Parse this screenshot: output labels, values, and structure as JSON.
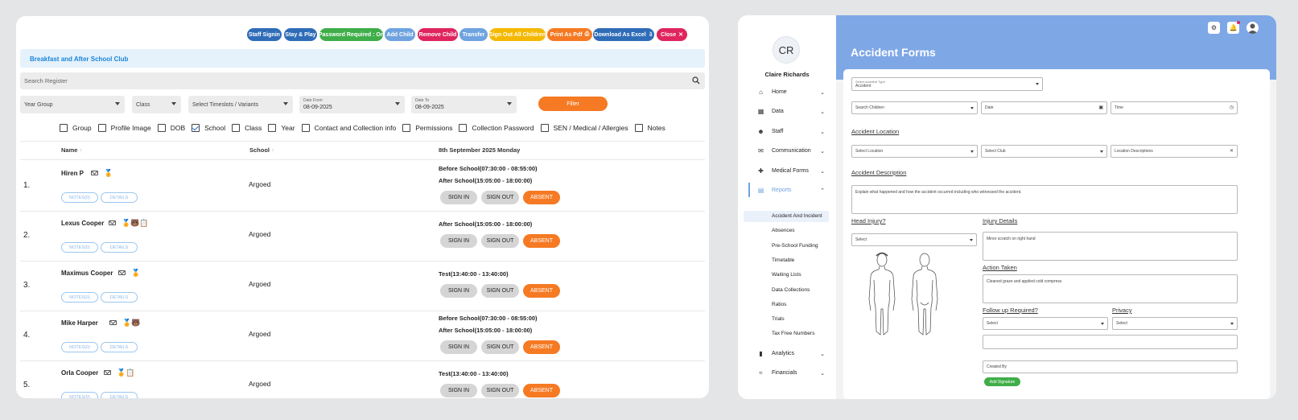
{
  "toolbar": {
    "buttons": [
      {
        "label": "Staff Signin",
        "color": "#2f6cb8"
      },
      {
        "label": "Stay & Play",
        "color": "#2f6cb8"
      },
      {
        "label": "Password Required : On",
        "color": "#3fae49"
      },
      {
        "label": "Add Child",
        "color": "#6fa3e0"
      },
      {
        "label": "Remove Child",
        "color": "#e0245e"
      },
      {
        "label": "Transfer",
        "color": "#6fa3e0"
      },
      {
        "label": "Sign Out All Children",
        "color": "#f5b800"
      },
      {
        "label": "Print As Pdf",
        "color": "#f57a23"
      },
      {
        "label": "Download As Excel",
        "color": "#2f6cb8"
      },
      {
        "label": "Close",
        "color": "#e0245e"
      }
    ]
  },
  "register": {
    "banner": "Breakfast and After School Club",
    "search_placeholder": "Search Register",
    "filters": {
      "year_group": "Year Group",
      "class": "Class",
      "timeslots": "Select Timeslots / Variants",
      "date_from_label": "Date From",
      "date_from": "08-09-2025",
      "date_to_label": "Date To",
      "date_to": "08-09-2025",
      "filter_button": "Filter"
    },
    "columns_toggle": [
      {
        "label": "Group",
        "checked": false
      },
      {
        "label": "Profile Image",
        "checked": false
      },
      {
        "label": "DOB",
        "checked": false
      },
      {
        "label": "School",
        "checked": true
      },
      {
        "label": "Class",
        "checked": false
      },
      {
        "label": "Year",
        "checked": false
      },
      {
        "label": "Contact and Collection info",
        "checked": false
      },
      {
        "label": "Permissions",
        "checked": false
      },
      {
        "label": "Collection Password",
        "checked": false
      },
      {
        "label": "SEN / Medical / Allergies",
        "checked": false
      },
      {
        "label": "Notes",
        "checked": false
      }
    ],
    "headers": {
      "name": "Name",
      "school": "School",
      "date": "8th September 2025 Monday"
    },
    "notes_label": "NOTES(0)",
    "details_label": "DETAILS",
    "sign_in": "SIGN IN",
    "sign_out": "SIGN OUT",
    "absent": "ABSENT",
    "rows": [
      {
        "num": "1.",
        "name": "Hiren P",
        "school": "Argoed",
        "sessions": [
          "Before School(07:30:00 - 08:55:00)",
          "After School(15:05:00 - 18:00:00)"
        ]
      },
      {
        "num": "2.",
        "name": "Lexus Cooper",
        "school": "Argoed",
        "sessions": [
          "After School(15:05:00 - 18:00:00)"
        ]
      },
      {
        "num": "3.",
        "name": "Maximus Cooper",
        "school": "Argoed",
        "sessions": [
          "Test(13:40:00 - 13:40:00)"
        ]
      },
      {
        "num": "4.",
        "name": "Mike Harper",
        "school": "Argoed",
        "sessions": [
          "Before School(07:30:00 - 08:55:00)",
          "After School(15:05:00 - 18:00:00)"
        ]
      },
      {
        "num": "5.",
        "name": "Orla Cooper",
        "school": "Argoed",
        "sessions": [
          "Test(13:40:00 - 13:40:00)"
        ]
      }
    ]
  },
  "sidebar": {
    "initials": "CR",
    "user_name": "Claire Richards",
    "items": [
      {
        "label": "Home",
        "icon": "home-icon"
      },
      {
        "label": "Data",
        "icon": "book-icon"
      },
      {
        "label": "Staff",
        "icon": "person-icon"
      },
      {
        "label": "Communication",
        "icon": "mail-icon"
      },
      {
        "label": "Medical Forms",
        "icon": "medical-cross-icon"
      },
      {
        "label": "Reports",
        "icon": "chart-icon"
      }
    ],
    "report_subitems": [
      "Accident And Incident",
      "Absences",
      "Pre-School Funding",
      "Timetable",
      "Waiting Lists",
      "Data Collections",
      "Ratios",
      "Trials",
      "Tax Free Numbers"
    ],
    "bottom_items": [
      {
        "label": "Analytics",
        "icon": "bar-chart-icon"
      },
      {
        "label": "Financials",
        "icon": "handshake-icon"
      }
    ]
  },
  "accident_form": {
    "title": "Accident Forms",
    "accident_type_label": "Select accident Type",
    "accident_type": "Accident",
    "search_children": "Search Children",
    "date": "Date",
    "time": "Time",
    "location_heading": "Accident Location",
    "select_location": "Select Location",
    "select_club": "Select Club",
    "location_descriptions": "Location Descriptions",
    "description_heading": "Accident Description",
    "description_text": "Explain what happened and how the accident occurred including who witnessed the accident.",
    "head_injury_heading": "Head Injury?",
    "head_injury_value": "Select",
    "injury_details_heading": "Injury Details",
    "injury_details_text": "Minor scratch on right hand",
    "action_taken_heading": "Action Taken",
    "action_taken_text": "Cleaned graze and applied cold compress",
    "follow_up_heading": "Follow up Required?",
    "follow_up_value": "Select",
    "privacy_heading": "Privacy",
    "privacy_value": "Select",
    "created_by": "Created By",
    "add_signature": "Add Signature"
  }
}
